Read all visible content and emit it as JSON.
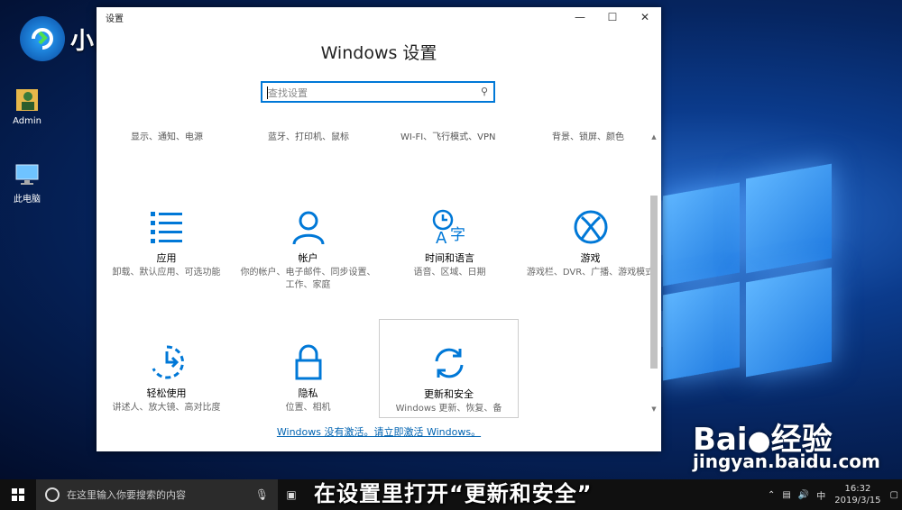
{
  "brand": {
    "name": "小白系统"
  },
  "desktop": {
    "icons": [
      {
        "label": "Admin",
        "icon": "user-folder-icon"
      },
      {
        "label": "此电脑",
        "icon": "computer-icon"
      }
    ]
  },
  "window": {
    "titlebar": "设置",
    "heading": "Windows 设置",
    "search_placeholder": "查找设置",
    "cut_row": [
      "显示、通知、电源",
      "蓝牙、打印机、鼠标",
      "WI-FI、飞行模式、VPN",
      "背景、锁屏、颜色"
    ],
    "tiles": [
      {
        "name": "应用",
        "desc": "卸载、默认应用、可选功能",
        "icon": "apps-list-icon"
      },
      {
        "name": "帐户",
        "desc": "你的帐户、电子邮件、同步设置、工作、家庭",
        "icon": "account-person-icon"
      },
      {
        "name": "时间和语言",
        "desc": "语音、区域、日期",
        "icon": "time-language-icon"
      },
      {
        "name": "游戏",
        "desc": "游戏栏、DVR、广播、游戏模式",
        "icon": "xbox-icon"
      },
      {
        "name": "轻松使用",
        "desc": "讲述人、放大镜、高对比度",
        "icon": "ease-of-access-icon"
      },
      {
        "name": "隐私",
        "desc": "位置、相机",
        "icon": "privacy-lock-icon"
      },
      {
        "name": "更新和安全",
        "desc": "Windows 更新、恢复、备",
        "icon": "update-sync-icon"
      }
    ],
    "activate_link": "Windows 没有激活。请立即激活 Windows。"
  },
  "taskbar": {
    "search_placeholder": "在这里输入你要搜索的内容",
    "ime": "中",
    "time": "16:32",
    "date": "2019/3/15"
  },
  "overlay": {
    "subtitle": "在设置里打开“更新和安全”",
    "watermark": "Bai",
    "watermark_cn": "经验",
    "watermark_url": "jingyan.baidu.com"
  },
  "colors": {
    "accent": "#0078d7",
    "link": "#0063b1"
  }
}
